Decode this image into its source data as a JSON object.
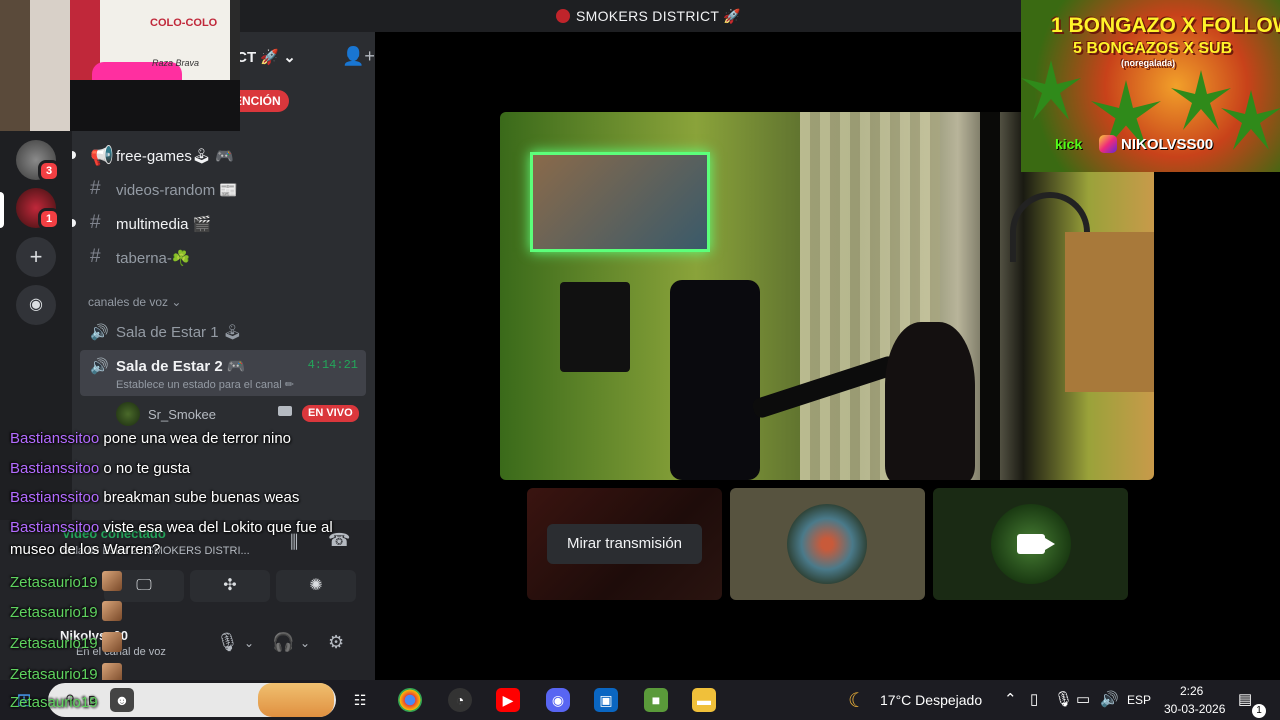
{
  "window": {
    "title": "SMOKERS DISTRICT 🚀"
  },
  "server": {
    "name": "ICT 🚀",
    "tag_button": "ENCIÓN"
  },
  "rail": {
    "badges": [
      "3",
      "1"
    ]
  },
  "channels": [
    {
      "icon": "📢",
      "label": "free-games🕹 🎮"
    },
    {
      "icon": "#",
      "label": "videos-random 📰"
    },
    {
      "icon": "#",
      "label": "multimedia 🎬"
    },
    {
      "icon": "#",
      "label": "taberna-☘️"
    }
  ],
  "voice_category": "canales de voz ⌄",
  "voice_channels": [
    {
      "label": "Sala de Estar 1 🕹"
    },
    {
      "label": "Sala de Estar 2 🎮",
      "time": "4:14:21",
      "status": "Establece un estado para el canal ✏"
    }
  ],
  "voice_user": {
    "name": "Sr_Smokee",
    "live": "EN VIVO"
  },
  "connection": {
    "status": "Video conectado",
    "sub": "Sala de Estar 2 / SMOKERS DISTRI..."
  },
  "user_panel": {
    "name": "Nikolvss00",
    "sub": "En el canal de voz"
  },
  "chat": [
    {
      "user": "Bastianssitoo",
      "msg": "pone una wea de terror nino"
    },
    {
      "user": "Bastianssitoo",
      "msg": "o no te gusta"
    },
    {
      "user": "Bastianssitoo",
      "msg": "breakman sube buenas weas"
    },
    {
      "user": "Bastianssitoo",
      "msg": "viste esa wea del Lokito que fue al"
    },
    {
      "user": "",
      "msg": "museo de los Warren?"
    },
    {
      "user": "Zetasaurio19",
      "msg": ""
    },
    {
      "user": "Zetasaurio19",
      "msg": ""
    },
    {
      "user": "Zetasaurio19",
      "msg": ""
    },
    {
      "user": "Zetasaurio19",
      "msg": ""
    },
    {
      "user": "Zetasaurio19",
      "msg": ""
    }
  ],
  "stream": {
    "watch_button": "Mirar transmisión"
  },
  "webcam": {
    "jersey_text": "COLO-COLO",
    "brand": "Raza Brava"
  },
  "promo": {
    "line1": "1 BONGAZO X FOLLOW",
    "line2": "5 BONGAZOS X SUB",
    "line3": "(noregalada)",
    "kick": "kick",
    "handle": "NIKOLVSS00"
  },
  "taskbar": {
    "search_text": "B",
    "weather": "17°C  Despejado",
    "lang": "ESP",
    "time": "2:26",
    "date": "30-03-2026",
    "notifications": "1"
  },
  "colors": {
    "accent": "#23a55a",
    "danger": "#da373c",
    "sidebar": "#2b2d31",
    "rail": "#1e1f22"
  }
}
